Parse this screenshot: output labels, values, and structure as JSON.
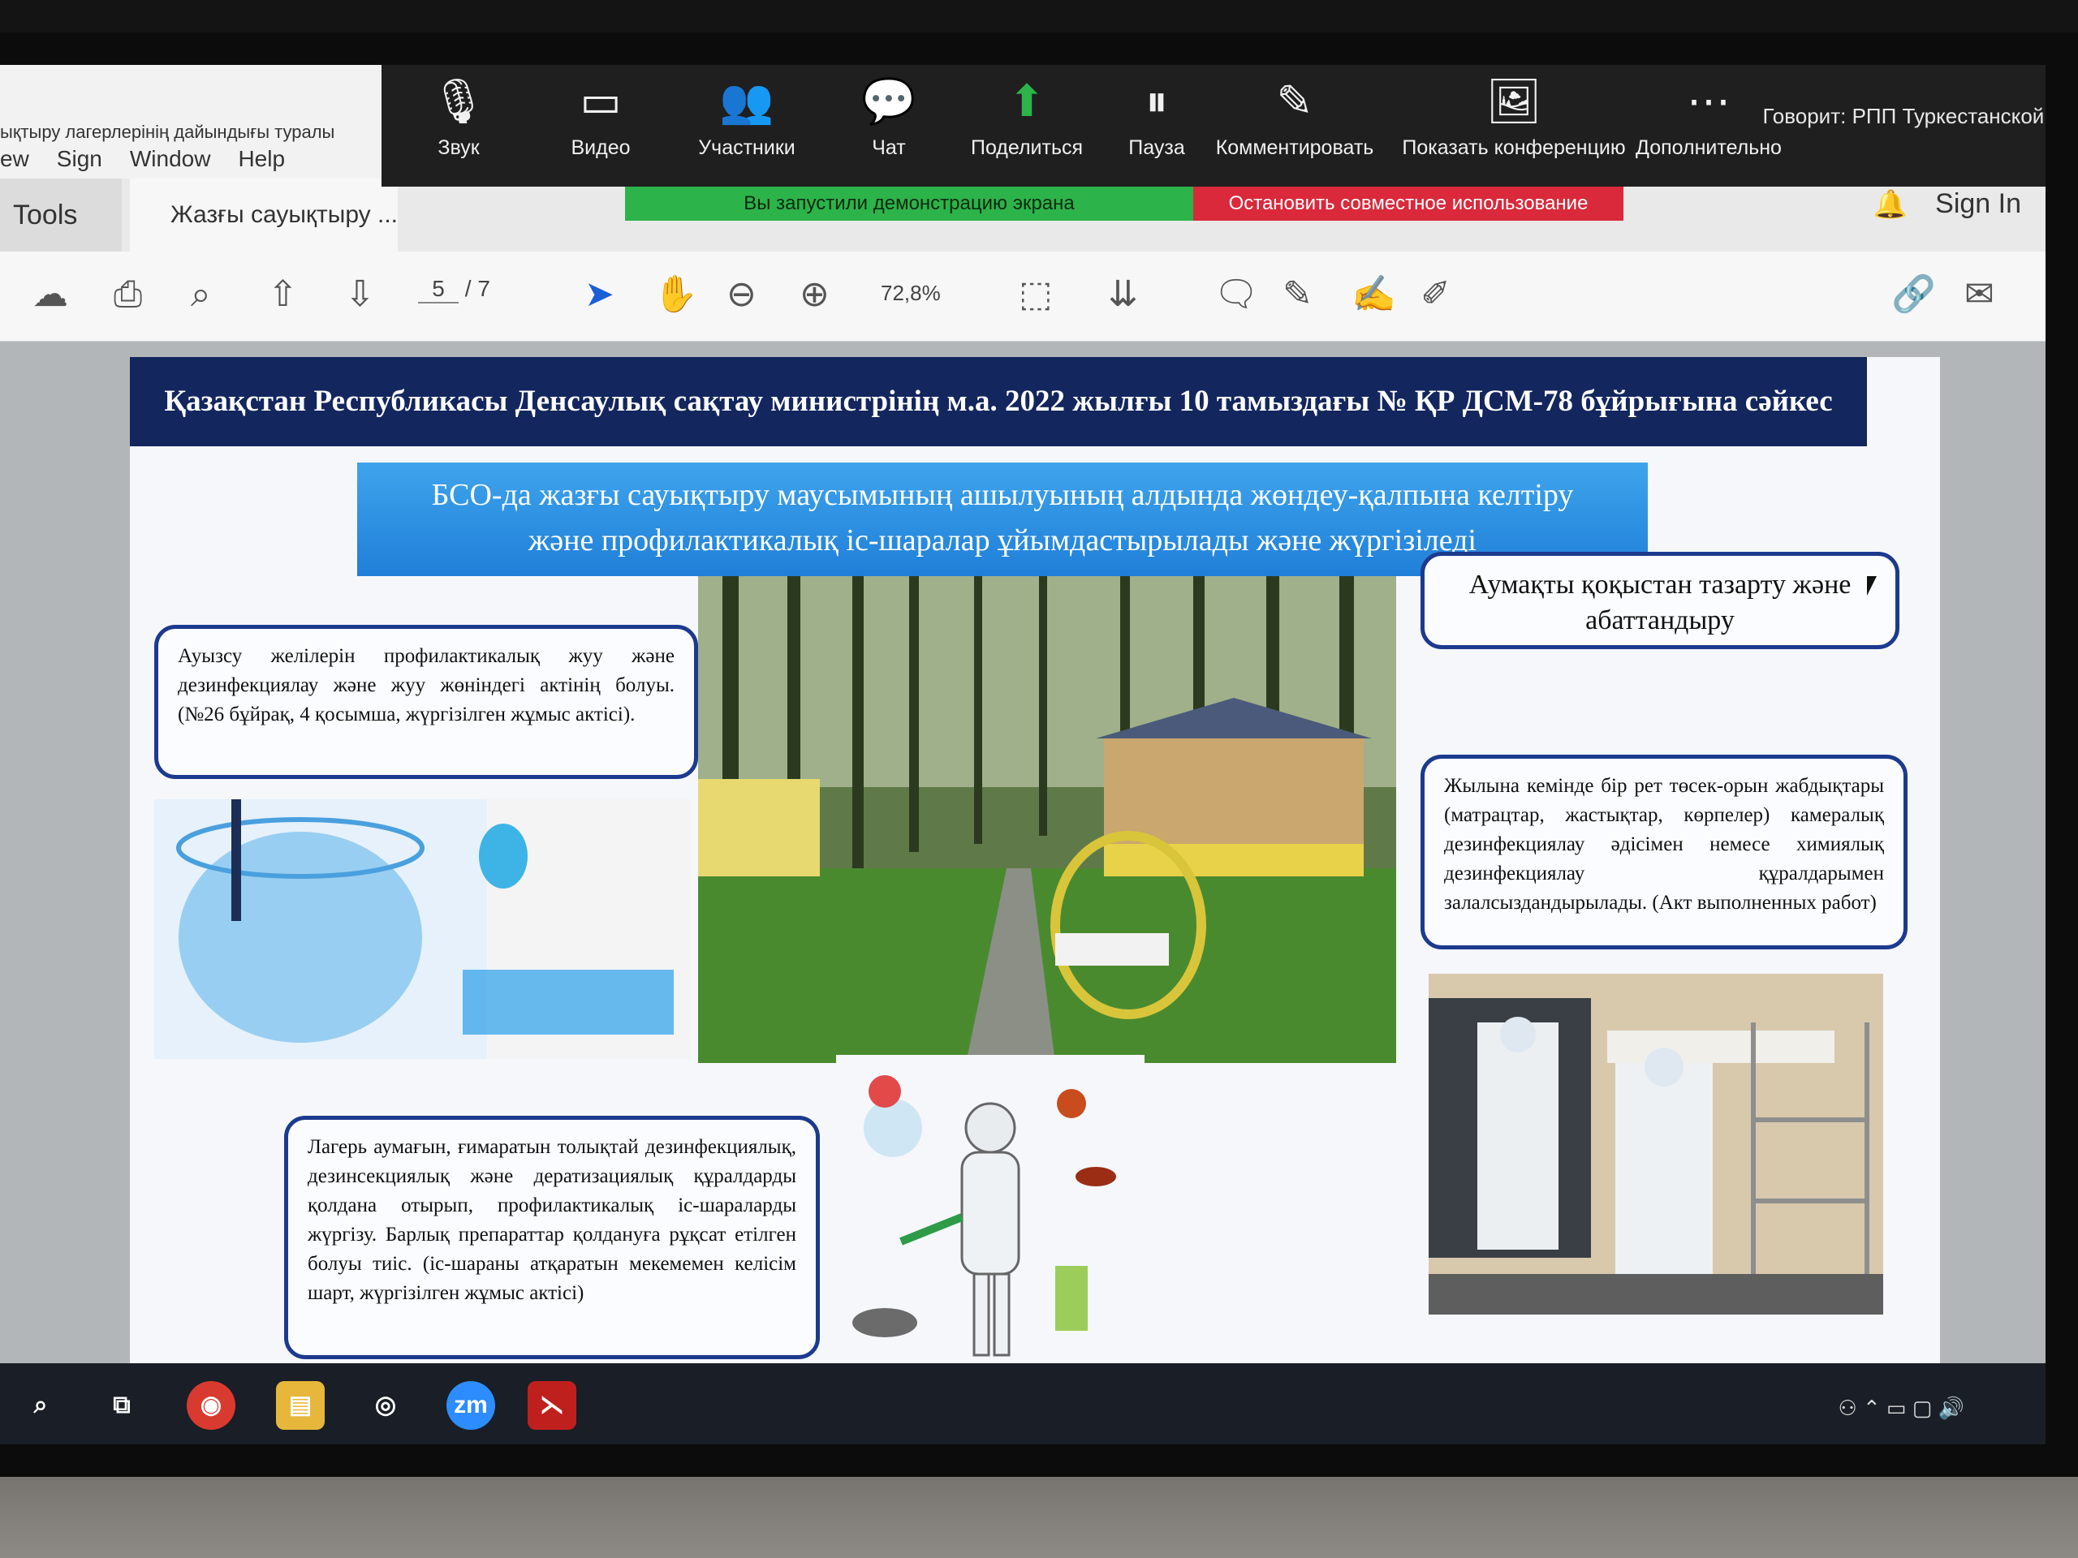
{
  "acrobat": {
    "doc_title_fragment": "ықтыру лагерлерінің дайындығы туралы",
    "menu": [
      "ew",
      "Sign",
      "Window",
      "Help"
    ],
    "tab_tools": "Tools",
    "tab_document": "Жазғы сауықтыру ...",
    "sign_in": "Sign In",
    "page_current": "5",
    "page_total": "/ 7",
    "zoom": "72,8%"
  },
  "zoom": {
    "controls": [
      {
        "label": "Звук",
        "icon": "microphone-icon"
      },
      {
        "label": "Видео",
        "icon": "video-camera-icon"
      },
      {
        "label": "Участники",
        "icon": "participants-icon"
      },
      {
        "label": "Чат",
        "icon": "chat-icon"
      },
      {
        "label": "Поделиться",
        "icon": "share-screen-icon"
      },
      {
        "label": "Пауза",
        "icon": "pause-icon"
      },
      {
        "label": "Комментировать",
        "icon": "annotate-pen-icon"
      },
      {
        "label": "Показать конференцию",
        "icon": "show-meeting-icon"
      },
      {
        "label": "Дополнительно",
        "icon": "more-icon"
      }
    ],
    "speaking_label": "Говорит:",
    "speaking_name": "РПП Туркестанской...",
    "share_banner": "Вы запустили демонстрацию экрана",
    "stop_share": "Остановить совместное использование",
    "colors": {
      "share_green": "#2cb34a",
      "stop_red": "#d9293a"
    }
  },
  "slide": {
    "header": "Қазақстан Республикасы Денсаулық сақтау министрінің м.а. 2022 жылғы 10 тамыздағы № ҚР ДСМ-78 бұйрығына сәйкес",
    "subtitle_line1": "БСО-да жазғы сауықтыру маусымының ашылуының алдында жөндеу-қалпына келтіру",
    "subtitle_line2": "және профилактикалық іс-шаралар ұйымдастырылады және жүргізіледі",
    "box_water": "Ауызсу желілерін профилактикалық жуу және дезинфекциялау және жуу жөніндегі актінің болуы. (№26 бұйрақ, 4 қосымша, жүргізілген жұмыс актісі).",
    "box_territory": "Аумақты қоқыстан тазарту және абаттандыру",
    "box_bedding": "Жылына кемінде бір рет төсек-орын жабдықтары (матрацтар, жастықтар, көрпелер) камералық дезинфекциялау әдісімен немесе химиялық дезинфекциялау құралдарымен залалсыздандырылады. (Акт выполненных работ)",
    "box_disinfection": "Лагерь аумағын, ғимаратын толықтай дезинфекциялық, дезинсекциялық және дератизациялық құралдарды қолдана отырып, профилактикалық іс-шараларды жүргізу. Барлық препараттар қолдануға рұқсат етілген болуы тиіс. (іс-шараны атқаратын мекемемен келісім шарт, жүргізілген жұмыс актісі)",
    "colors": {
      "header_bg": "#13265e",
      "box_border": "#1c3a8e",
      "subtitle_bg": "#2a8fe2"
    }
  },
  "taskbar": {
    "zoom_app_label": "zm"
  }
}
